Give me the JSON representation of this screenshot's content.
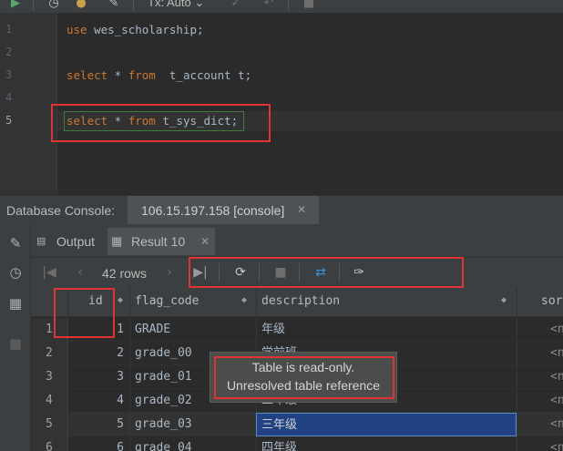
{
  "toolbar": {
    "transaction_mode": "Tx: Auto",
    "icons": [
      "run-icon",
      "history-icon",
      "profile-icon",
      "wrench-icon",
      "commit-icon",
      "rollback-icon",
      "stop-icon"
    ]
  },
  "editor": {
    "lines": [
      {
        "number": "1",
        "keyword": "use",
        "rest": " wes_scholarship;"
      },
      {
        "number": "2",
        "keyword": "",
        "rest": ""
      },
      {
        "number": "3",
        "keyword": "select",
        "star": " * ",
        "from": "from",
        "rest": "  t_account t;"
      },
      {
        "number": "4",
        "keyword": "",
        "rest": ""
      },
      {
        "number": "5",
        "keyword": "select",
        "star": " * ",
        "from": "from",
        "rest": " t_sys_dict;"
      }
    ],
    "active_line": "5"
  },
  "console": {
    "title": "Database Console:",
    "tab_label": "106.15.197.158 [console]"
  },
  "result_tabs": [
    {
      "label": "Output",
      "icon": "output-icon"
    },
    {
      "label": "Result 10",
      "icon": "table-grid-icon"
    }
  ],
  "grid_toolbar": {
    "rows_label": "42 rows"
  },
  "table": {
    "columns": [
      "id",
      "flag_code",
      "description",
      "sor"
    ],
    "rows": [
      {
        "row": "1",
        "id": "1",
        "flag_code": "GRADE",
        "description": "年级",
        "sort": "<n"
      },
      {
        "row": "2",
        "id": "2",
        "flag_code": "grade_00",
        "description": "学前班",
        "sort": "<n"
      },
      {
        "row": "3",
        "id": "3",
        "flag_code": "grade_01",
        "description": "一年级",
        "sort": "<n"
      },
      {
        "row": "4",
        "id": "4",
        "flag_code": "grade_02",
        "description": "二年级",
        "sort": "<n"
      },
      {
        "row": "5",
        "id": "5",
        "flag_code": "grade_03",
        "description": "三年级",
        "sort": "<n"
      },
      {
        "row": "6",
        "id": "6",
        "flag_code": "grade_04",
        "description": "四年级",
        "sort": "<n"
      }
    ],
    "selected_row": "5"
  },
  "tooltip": {
    "line1": "Table is read-only.",
    "line2": "Unresolved table reference"
  },
  "colors": {
    "keyword": "#cc7832",
    "highlight": "#e03434",
    "selection": "#214283"
  }
}
